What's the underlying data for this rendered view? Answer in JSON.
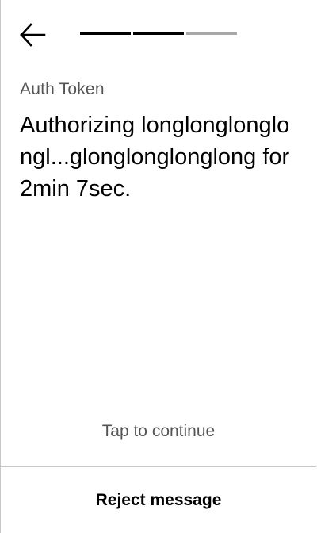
{
  "header": {
    "back_icon": "arrow-left-icon",
    "progress": {
      "total_steps": 3,
      "current_step": 2
    }
  },
  "content": {
    "subtitle": "Auth Token",
    "message": "Authorizing longlonglonglongl...glonglonglonglong for 2min 7sec."
  },
  "footer": {
    "tap_hint": "Tap to continue",
    "reject_label": "Reject message"
  },
  "colors": {
    "text_primary": "#000000",
    "text_secondary": "#555555",
    "progress_active": "#000000",
    "progress_inactive": "#a8a8a8",
    "divider": "#c8c8c8"
  }
}
